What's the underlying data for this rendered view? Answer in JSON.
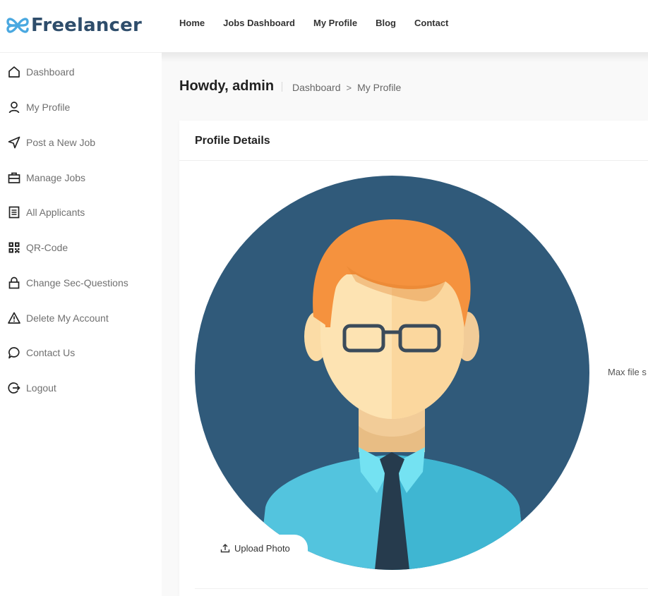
{
  "brand": {
    "name": "Freelancer",
    "accent": "#2e4d6b",
    "logo_icon_color": "#4aa8e0"
  },
  "nav": {
    "items": [
      {
        "label": "Home"
      },
      {
        "label": "Jobs Dashboard"
      },
      {
        "label": "My Profile"
      },
      {
        "label": "Blog"
      },
      {
        "label": "Contact"
      }
    ]
  },
  "sidebar": {
    "items": [
      {
        "label": "Dashboard",
        "icon": "home-icon"
      },
      {
        "label": "My Profile",
        "icon": "user-icon"
      },
      {
        "label": "Post a New Job",
        "icon": "send-icon"
      },
      {
        "label": "Manage Jobs",
        "icon": "briefcase-icon"
      },
      {
        "label": "All Applicants",
        "icon": "document-list-icon"
      },
      {
        "label": "QR-Code",
        "icon": "qr-code-icon"
      },
      {
        "label": "Change Sec-Questions",
        "icon": "lock-icon"
      },
      {
        "label": "Delete My Account",
        "icon": "warning-icon"
      },
      {
        "label": "Contact Us",
        "icon": "chat-bubble-icon"
      },
      {
        "label": "Logout",
        "icon": "logout-icon"
      }
    ]
  },
  "page": {
    "greeting": "Howdy, admin",
    "breadcrumb": {
      "root": "Dashboard",
      "separator": ">",
      "current": "My Profile"
    }
  },
  "profile_card": {
    "title": "Profile Details",
    "upload_label": "Upload Photo",
    "upload_icon": "upload-icon",
    "max_file_text": "Max file s",
    "avatar_bg_color": "#305a7a"
  }
}
